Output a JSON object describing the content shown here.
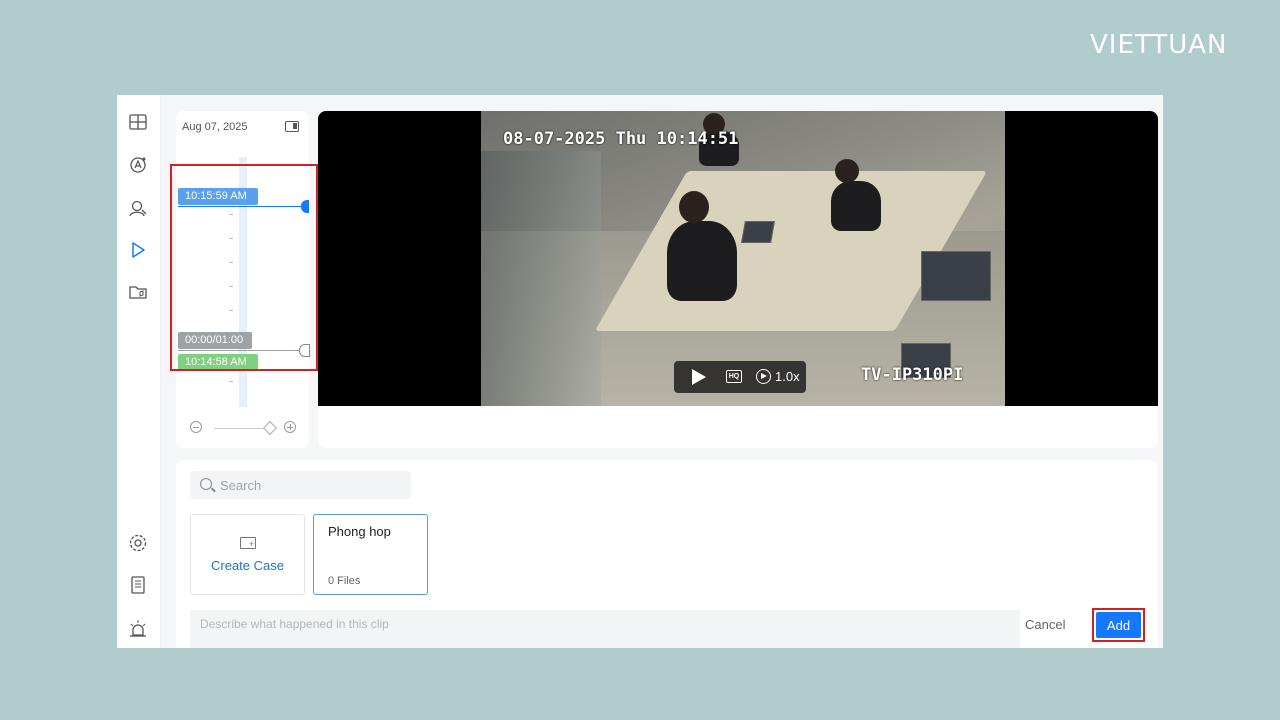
{
  "brand": {
    "logo_text": "VIETTUAN"
  },
  "sidebar": {
    "top_icons": [
      "layout-grid-icon",
      "ai-analytics-icon",
      "face-recognition-icon",
      "playback-icon",
      "case-folder-icon"
    ],
    "bottom_icons": [
      "settings-icon",
      "log-icon",
      "alarm-icon"
    ],
    "active": "playback-icon"
  },
  "timeline": {
    "date": "Aug 07, 2025",
    "start_time": "10:15:59 AM",
    "duration": "00:00/01:00",
    "end_time": "10:14:58 AM",
    "accent_color": "#1677ff",
    "highlight_color": "#d02127"
  },
  "video": {
    "osd_timestamp": "08-07-2025 Thu 10:14:51",
    "osd_camera": "TV-IP310PI",
    "quality_label": "HQ",
    "speed_label": "1.0x"
  },
  "bottom": {
    "search_placeholder": "Search",
    "create_case_label": "Create Case",
    "cases": [
      {
        "title": "Phong hop",
        "files": "0 Files"
      }
    ],
    "description_placeholder": "Describe what happened in this clip",
    "cancel_label": "Cancel",
    "add_label": "Add"
  }
}
